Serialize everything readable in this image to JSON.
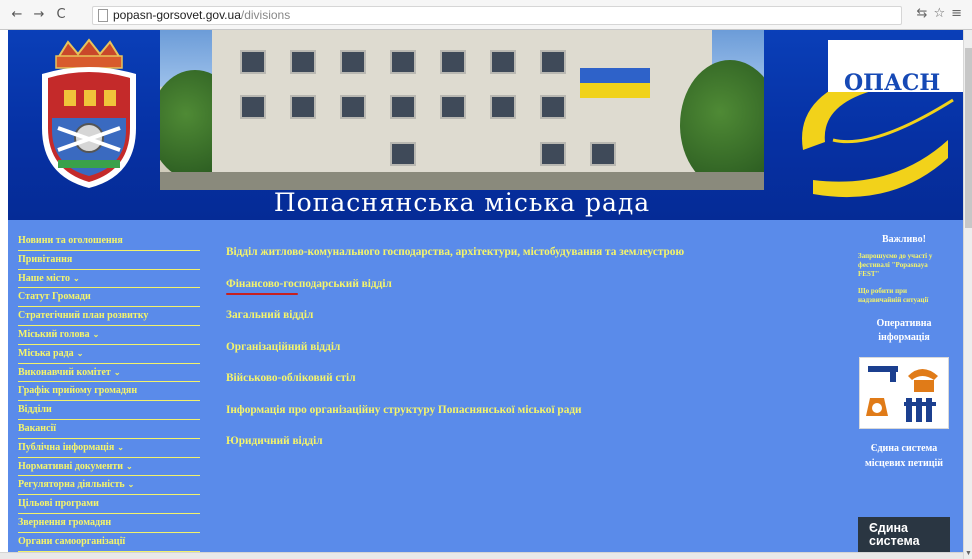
{
  "browser": {
    "back_icon": "←",
    "forward_icon": "→",
    "reload_icon": "C",
    "url_host": "popasn-gorsovet.gov.ua",
    "url_path": "/divisions",
    "tool_icons": [
      "translate-icon",
      "star-icon",
      "menu-icon"
    ]
  },
  "header": {
    "site_title": "Попаснянська міська рада",
    "logo_text": "ОПАСН"
  },
  "sidebar": {
    "items": [
      {
        "label": "Новини та оголошення",
        "dropdown": false
      },
      {
        "label": "Привітання",
        "dropdown": false
      },
      {
        "label": "Наше місто",
        "dropdown": true
      },
      {
        "label": "Статут Громади",
        "dropdown": false
      },
      {
        "label": "Стратегічний план розвитку",
        "dropdown": false
      },
      {
        "label": "Міський голова",
        "dropdown": true
      },
      {
        "label": "Міська рада",
        "dropdown": true
      },
      {
        "label": "Виконавчий комітет",
        "dropdown": true
      },
      {
        "label": "Графік прийому громадян",
        "dropdown": false
      },
      {
        "label": "Відділи",
        "dropdown": false
      },
      {
        "label": "Вакансії",
        "dropdown": false
      },
      {
        "label": "Публічна інформація",
        "dropdown": true
      },
      {
        "label": "Нормативні документи",
        "dropdown": true
      },
      {
        "label": "Регуляторна діяльність",
        "dropdown": true
      },
      {
        "label": "Цільові програми",
        "dropdown": false
      },
      {
        "label": "Звернення громадян",
        "dropdown": false
      },
      {
        "label": "Органи самоорганізації",
        "dropdown": false
      }
    ],
    "arrow": "⌄"
  },
  "main": {
    "links": [
      "Відділ житлово-комунального господарства, архітектури, містобудування та землеустрою",
      "Фінансово-господарський відділ",
      "Загальний відділ",
      "Організаційний відділ",
      "Військово-обліковий стіл",
      "Інформація про організаційну структуру Попаснянської міської ради",
      "Юридичний відділ"
    ]
  },
  "right": {
    "heading": "Важливо!",
    "notice1": "Запрошуємо до участі у фестивалі \"Popasnaya FEST\"",
    "notice2": "Що робити при надзвичайній ситуації",
    "operative": "Оперативна інформація",
    "petition_system": "Єдина система місцевих петицій",
    "box_text": "Єдина система"
  },
  "colors": {
    "page_bg": "#5a8bea",
    "link_yellow": "#f5f56a",
    "header_blue": "#0631a4"
  }
}
